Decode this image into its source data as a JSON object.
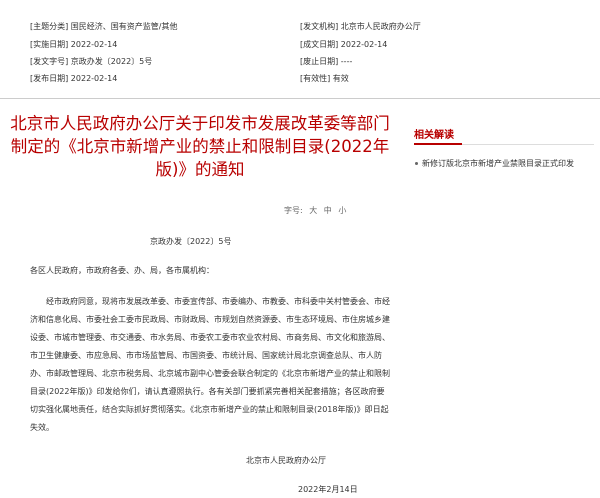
{
  "meta": {
    "left": [
      {
        "key": "[主题分类]",
        "value": "国民经济、国有资产监管/其他"
      },
      {
        "key": "[实施日期]",
        "value": "2022-02-14"
      },
      {
        "key": "[发文字号]",
        "value": "京政办发〔2022〕5号"
      },
      {
        "key": "[发布日期]",
        "value": "2022-02-14"
      }
    ],
    "right": [
      {
        "key": "[发文机构]",
        "value": "北京市人民政府办公厅"
      },
      {
        "key": "[成文日期]",
        "value": "2022-02-14"
      },
      {
        "key": "[废止日期]",
        "value": "----"
      },
      {
        "key": "[有效性]",
        "value": "有效"
      }
    ]
  },
  "article": {
    "title": "北京市人民政府办公厅关于印发市发展改革委等部门制定的《北京市新增产业的禁止和限制目录(2022年版)》的通知",
    "font_size_label": "字号:",
    "font_size_options": [
      "大",
      "中",
      "小"
    ],
    "doc_number": "京政办发〔2022〕5号",
    "addressee": "各区人民政府，市政府各委、办、局，各市属机构：",
    "body": "经市政府同意，现将市发展改革委、市委宣传部、市委编办、市教委、市科委中关村管委会、市经济和信息化局、市委社会工委市民政局、市财政局、市规划自然资源委、市生态环境局、市住房城乡建设委、市城市管理委、市交通委、市水务局、市委农工委市农业农村局、市商务局、市文化和旅游局、市卫生健康委、市应急局、市市场监管局、市国资委、市统计局、国家统计局北京调查总队、市人防办、市邮政管理局、北京市税务局、北京城市副中心管委会联合制定的《北京市新增产业的禁止和限制目录(2022年版)》印发给你们，请认真遵照执行。各有关部门要抓紧完善相关配套措施；各区政府要切实强化属地责任，结合实际抓好贯彻落实。《北京市新增产业的禁止和限制目录(2018年版)》即日起失效。",
    "signature": "北京市人民政府办公厅",
    "date": "2022年2月14日"
  },
  "sidebar": {
    "heading": "相关解读",
    "items": [
      "新修订版北京市新增产业禁限目录正式印发"
    ]
  }
}
